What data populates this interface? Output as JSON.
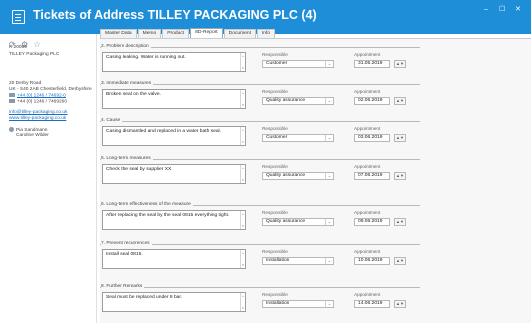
{
  "window": {
    "title": "Tickets of Address TILLEY PACKAGING PLC (4)",
    "minimize_glyph": "–",
    "maximize_glyph": "☐",
    "close_glyph": "✕"
  },
  "toolbar": {
    "icons": [
      "refresh-icon",
      "gear-icon",
      "star-icon"
    ],
    "glyphs": [
      "⟳",
      "⚙",
      "☆"
    ]
  },
  "address": {
    "id": "K 20059",
    "company": "TILLEY Packaging PLC",
    "street": "20 Derby Road",
    "city": "UK - S40 2AB Chesterfield, Derbyshire",
    "phone": "+44 (0) 1246 / 74692-0",
    "fax": "+44 (0) 1246 / 7469260",
    "email": "info@tilley-packaging.co.uk",
    "web": "www.tilley-packaging.co.uk",
    "contact1": "Pia Sandmann",
    "contact2": "Caroline Wilder"
  },
  "tabs": [
    "Master Data",
    "Memo",
    "Product",
    "8D-Report",
    "Document",
    "Info"
  ],
  "labels": {
    "responsible": "Responsible",
    "appointment": "Appointment",
    "spinner": "▲▼",
    "dropdown": "⌄"
  },
  "sections": [
    {
      "title": "2. Problem description",
      "text": "Casing leaking. Water is running out.",
      "responsible": "Customer",
      "date": "31.05.2019"
    },
    {
      "title": "3. Immediate measures",
      "text": "Broken seal on the valve.",
      "responsible": "Quality assurance",
      "date": "02.06.2019"
    },
    {
      "title": "4. Cause",
      "text": "Casing dismantled and replaced in a water bath seal.",
      "responsible": "Customer",
      "date": "03.06.2019"
    },
    {
      "title": "5. Long-term measures",
      "text": "Check the seal by supplier XX.",
      "responsible": "Quality assurance",
      "date": "07.06.2019"
    },
    {
      "title": "6. Long-term effectiveness of the measure",
      "text": "After replacing the seal by the seal 0815 everything tight.",
      "responsible": "Quality assurance",
      "date": "09.06.2019"
    },
    {
      "title": "7. Prevent recurrences",
      "text": "Install seal 0815.",
      "responsible": "Installation",
      "date": "10.06.2019"
    },
    {
      "title": "8. Further Remarks",
      "text": "Seal must be replaced under 8 bar.",
      "responsible": "Installation",
      "date": "14.06.2019"
    }
  ]
}
